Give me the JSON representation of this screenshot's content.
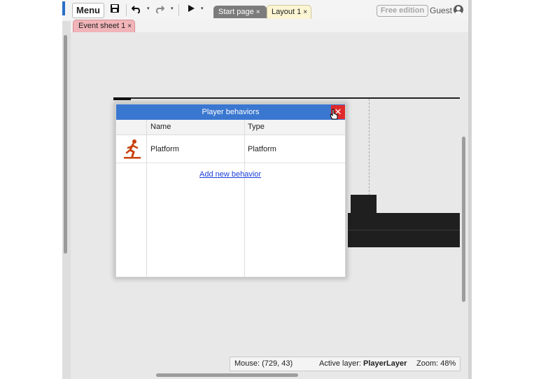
{
  "toolbar": {
    "menu_label": "Menu",
    "save_icon": "save-icon",
    "undo_icon": "undo-icon",
    "redo_icon": "redo-icon",
    "play_icon": "play-icon",
    "caret": "▾",
    "tabs": [
      {
        "label": "Start page",
        "close": "×"
      },
      {
        "label": "Layout 1",
        "close": "×"
      }
    ],
    "edition_label": "Free edition",
    "user_label": "Guest"
  },
  "subtabs": [
    {
      "label": "Event sheet 1",
      "close": "×"
    }
  ],
  "dialog": {
    "title": "Player behaviors",
    "close": "✕",
    "columns": [
      "Name",
      "Type"
    ],
    "rows": [
      {
        "icon": "running-person-icon",
        "name": "Platform",
        "type": "Platform"
      }
    ],
    "add_link": "Add new behavior"
  },
  "status": {
    "mouse_label": "Mouse:",
    "mouse_value": "(729, 43)",
    "layer_label": "Active layer:",
    "layer_value": "PlayerLayer",
    "zoom_label": "Zoom:",
    "zoom_value": "48%"
  },
  "colors": {
    "dialog_title": "#3a77d0",
    "close_button": "#e02a2a",
    "layout_tab": "#fbf5d3",
    "event_tab": "#f1b4b9",
    "behavior_icon": "#c8400e"
  }
}
